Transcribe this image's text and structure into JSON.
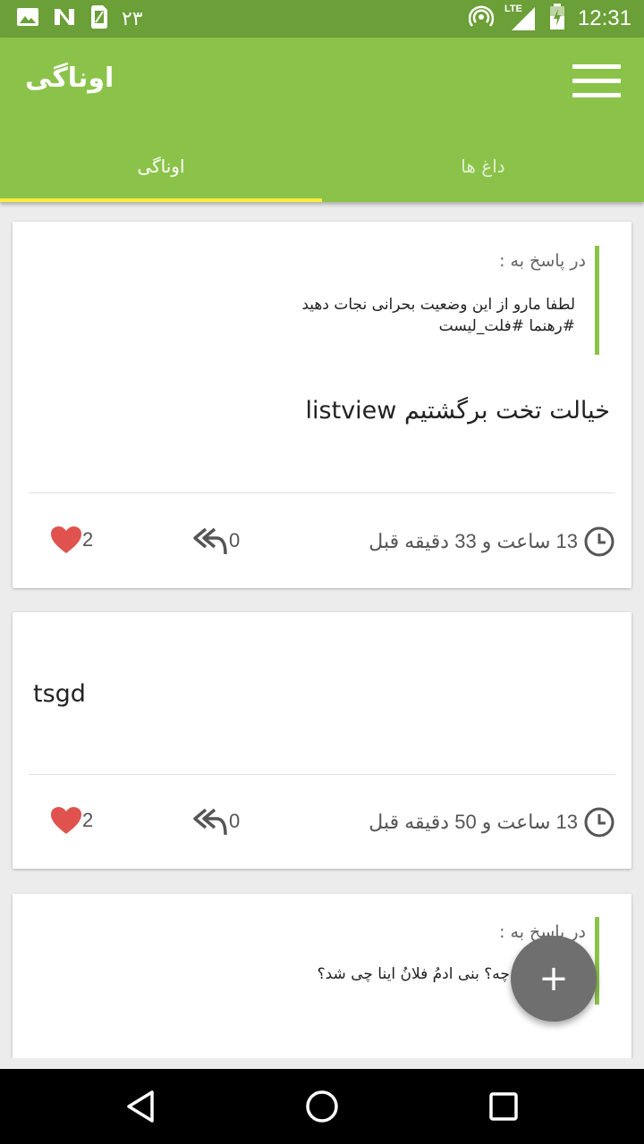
{
  "status_bar": {
    "date": "٢٣",
    "network": "LTE",
    "time": "12:31"
  },
  "app_bar": {
    "title": "اوناگی",
    "tabs": [
      {
        "label": "اوناگی",
        "active": true
      },
      {
        "label": "داغ ها",
        "active": false
      }
    ]
  },
  "posts": [
    {
      "reply_label": "در پاسخ به :",
      "reply_lines": [
        "لطفا مارو از این وضعیت بحرانی نجات دهید",
        "#رهنما #فلت_لیست"
      ],
      "text": "خیالت تخت برگشتیم listview",
      "time": "13 ساعت و 33 دقیقه قبل",
      "replies": "0",
      "likes": "2"
    },
    {
      "text": "tsgd",
      "time": "13 ساعت و 50 دقیقه قبل",
      "replies": "0",
      "likes": "2"
    },
    {
      "reply_label": "در پاسخ به :",
      "reply_lines": [
        "س به کی چه؟ بنی ادمُ فلانُ اینا چی شد؟"
      ]
    }
  ],
  "fab": {
    "label": "+"
  },
  "colors": {
    "primary": "#8bc34a",
    "status_bar": "#6b9f37",
    "accent": "#ffeb3b",
    "heart": "#e0524d",
    "fab": "#6f6f6f"
  },
  "icons": [
    "image-icon",
    "no-sim-icon",
    "sim-icon",
    "hotspot-icon",
    "signal-icon",
    "battery-icon",
    "menu-icon",
    "clock-icon",
    "reply-all-icon",
    "heart-icon",
    "back-icon",
    "home-icon",
    "recents-icon"
  ]
}
